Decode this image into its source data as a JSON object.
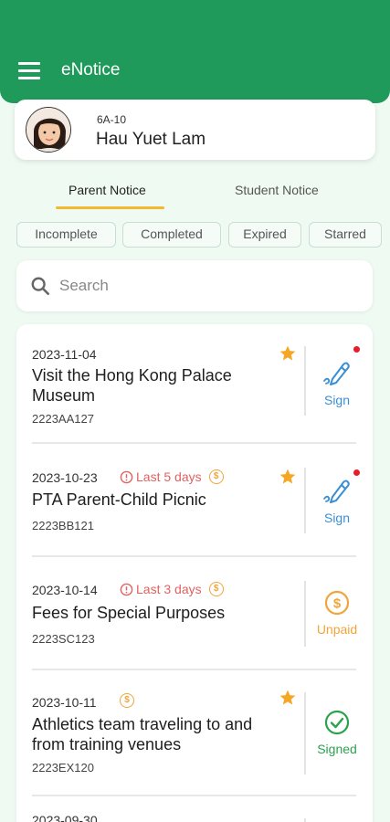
{
  "app": {
    "title": "eNotice"
  },
  "profile": {
    "class_label": "6A-10",
    "name": "Hau Yuet Lam"
  },
  "tabs": [
    {
      "label": "Parent Notice",
      "active": true
    },
    {
      "label": "Student Notice",
      "active": false
    }
  ],
  "filters": [
    "Incomplete",
    "Completed",
    "Expired",
    "Starred"
  ],
  "search": {
    "placeholder": "Search",
    "value": ""
  },
  "notices": [
    {
      "date": "2023-11-04",
      "warning": "",
      "fee_icon": false,
      "title_lines": [
        "Visit the Hong Kong Palace",
        "Museum"
      ],
      "code": "2223AA127",
      "starred": true,
      "action": "Sign",
      "unread": true
    },
    {
      "date": "2023-10-23",
      "warning": "Last 5 days",
      "fee_icon": true,
      "title_lines": [
        "PTA Parent-Child Picnic"
      ],
      "code": "2223BB121",
      "starred": true,
      "action": "Sign",
      "unread": true
    },
    {
      "date": "2023-10-14",
      "warning": "Last 3 days",
      "fee_icon": true,
      "title_lines": [
        "Fees for Special Purposes"
      ],
      "code": "2223SC123",
      "starred": false,
      "action": "Unpaid",
      "unread": false
    },
    {
      "date": "2023-10-11",
      "warning": "",
      "fee_icon": true,
      "title_lines": [
        "Athletics team traveling to and",
        "from training venues"
      ],
      "code": "2223EX120",
      "starred": true,
      "action": "Signed",
      "unread": false
    },
    {
      "date": "2023-09-30",
      "warning": "",
      "fee_icon": false,
      "title_lines": [],
      "code": "",
      "starred": false,
      "action": "",
      "unread": false
    }
  ],
  "icons": {
    "fee": "$",
    "warning": "!"
  },
  "colors": {
    "primary": "#209a5b",
    "background": "#eefaf2",
    "tab_underline": "#f5b82e",
    "warning": "#e06262",
    "star": "#f5a623",
    "sign": "#3a8fd4",
    "unpaid": "#f0a53a",
    "signed": "#2ca24f",
    "unread_dot": "#e81c2b"
  }
}
